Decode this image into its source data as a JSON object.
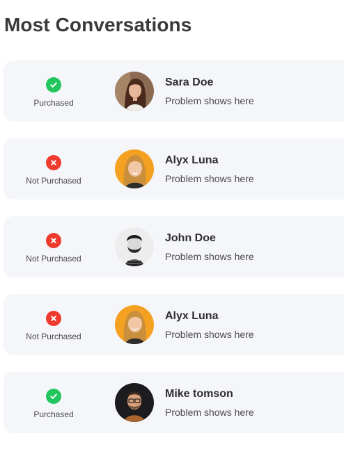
{
  "title": "Most Conversations",
  "conversations": [
    {
      "name": "Sara Doe",
      "problem": "Problem shows here",
      "status": "Purchased",
      "purchased": true,
      "avatar": "woman-brown-hair"
    },
    {
      "name": "Alyx Luna",
      "problem": "Problem shows here",
      "status": "Not Purchased",
      "purchased": false,
      "avatar": "woman-blonde-orange-bg"
    },
    {
      "name": "John Doe",
      "problem": "Problem shows here",
      "status": "Not Purchased",
      "purchased": false,
      "avatar": "man-beard-bw"
    },
    {
      "name": "Alyx Luna",
      "problem": "Problem shows here",
      "status": "Not Purchased",
      "purchased": false,
      "avatar": "woman-blonde-orange-bg"
    },
    {
      "name": "Mike tomson",
      "problem": "Problem shows here",
      "status": "Purchased",
      "purchased": true,
      "avatar": "man-glasses"
    }
  ],
  "colors": {
    "success": "#22c55e",
    "danger": "#ef3b2d",
    "card_bg": "#f5f6fa",
    "title": "#3a3a3c"
  }
}
